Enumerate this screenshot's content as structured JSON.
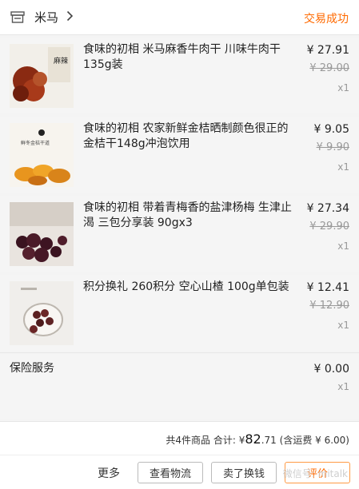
{
  "header": {
    "store_name": "米马",
    "status": "交易成功",
    "status_color": "#ff6a00",
    "store_icon": "store-icon",
    "chevron_icon": "chevron-right-icon"
  },
  "items": [
    {
      "title": "食味的初相 米马麻香牛肉干 川味牛肉干135g装",
      "price": "¥ 27.91",
      "original_price": "¥ 29.00",
      "quantity": "x1",
      "thumb_text": "麻辣"
    },
    {
      "title": "食味的初相 农家新鲜金桔晒制颜色很正的金桔干148g冲泡饮用",
      "price": "¥ 9.05",
      "original_price": "¥ 9.90",
      "quantity": "x1",
      "thumb_text": "鲜冬金桔干道"
    },
    {
      "title": "食味的初相 带着青梅香的盐津杨梅 生津止渴 三包分享装 90gx3",
      "price": "¥ 27.34",
      "original_price": "¥ 29.90",
      "quantity": "x1"
    },
    {
      "title": "积分换礼 260积分 空心山楂 100g单包装",
      "price": "¥ 12.41",
      "original_price": "¥ 12.90",
      "quantity": "x1"
    }
  ],
  "insurance": {
    "label": "保险服务",
    "price": "¥ 0.00",
    "quantity": "x1"
  },
  "summary": {
    "count_text": "共4件商品",
    "total_label": "合计: ¥",
    "total_whole": "82",
    "total_cents": ".71",
    "shipping_text": "(含运费 ¥ 6.00)"
  },
  "actions": {
    "more": "更多",
    "logistics": "查看物流",
    "resell": "卖了换钱",
    "review": "评价",
    "watermark": "微信号: mitalk"
  }
}
